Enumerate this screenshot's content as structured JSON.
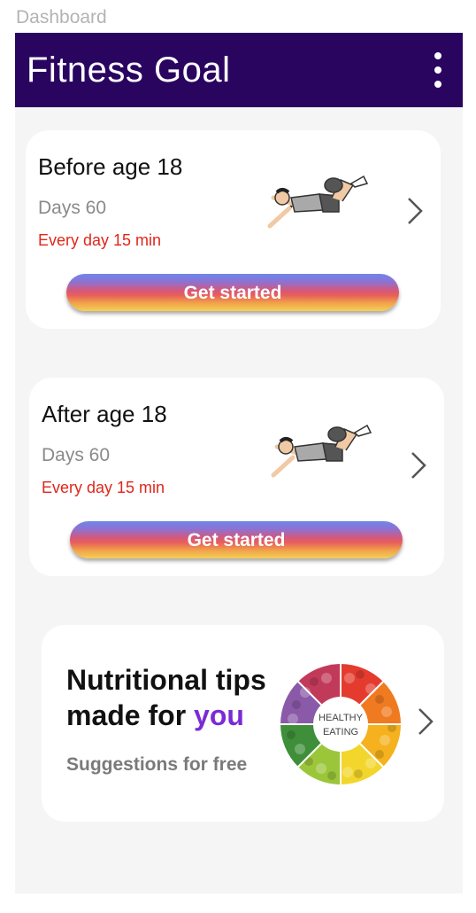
{
  "frame_label": "Dashboard",
  "appbar": {
    "title": "Fitness Goal"
  },
  "cards": [
    {
      "title": "Before age 18",
      "days": "Days 60",
      "time": "Every day 15 min",
      "button": "Get started"
    },
    {
      "title": "After age 18",
      "days": "Days 60",
      "time": "Every day 15 min",
      "button": "Get started"
    }
  ],
  "nutrition": {
    "title_line1": "Nutritional tips",
    "title_line2_prefix": "made for ",
    "title_highlight": "you",
    "subtitle": "Suggestions for free",
    "wheel_text_line1": "HEALTHY",
    "wheel_text_line2": "EATING"
  },
  "colors": {
    "appbar": "#2a0560",
    "accent_red": "#e0261b",
    "accent_purple": "#7a2bd6"
  }
}
